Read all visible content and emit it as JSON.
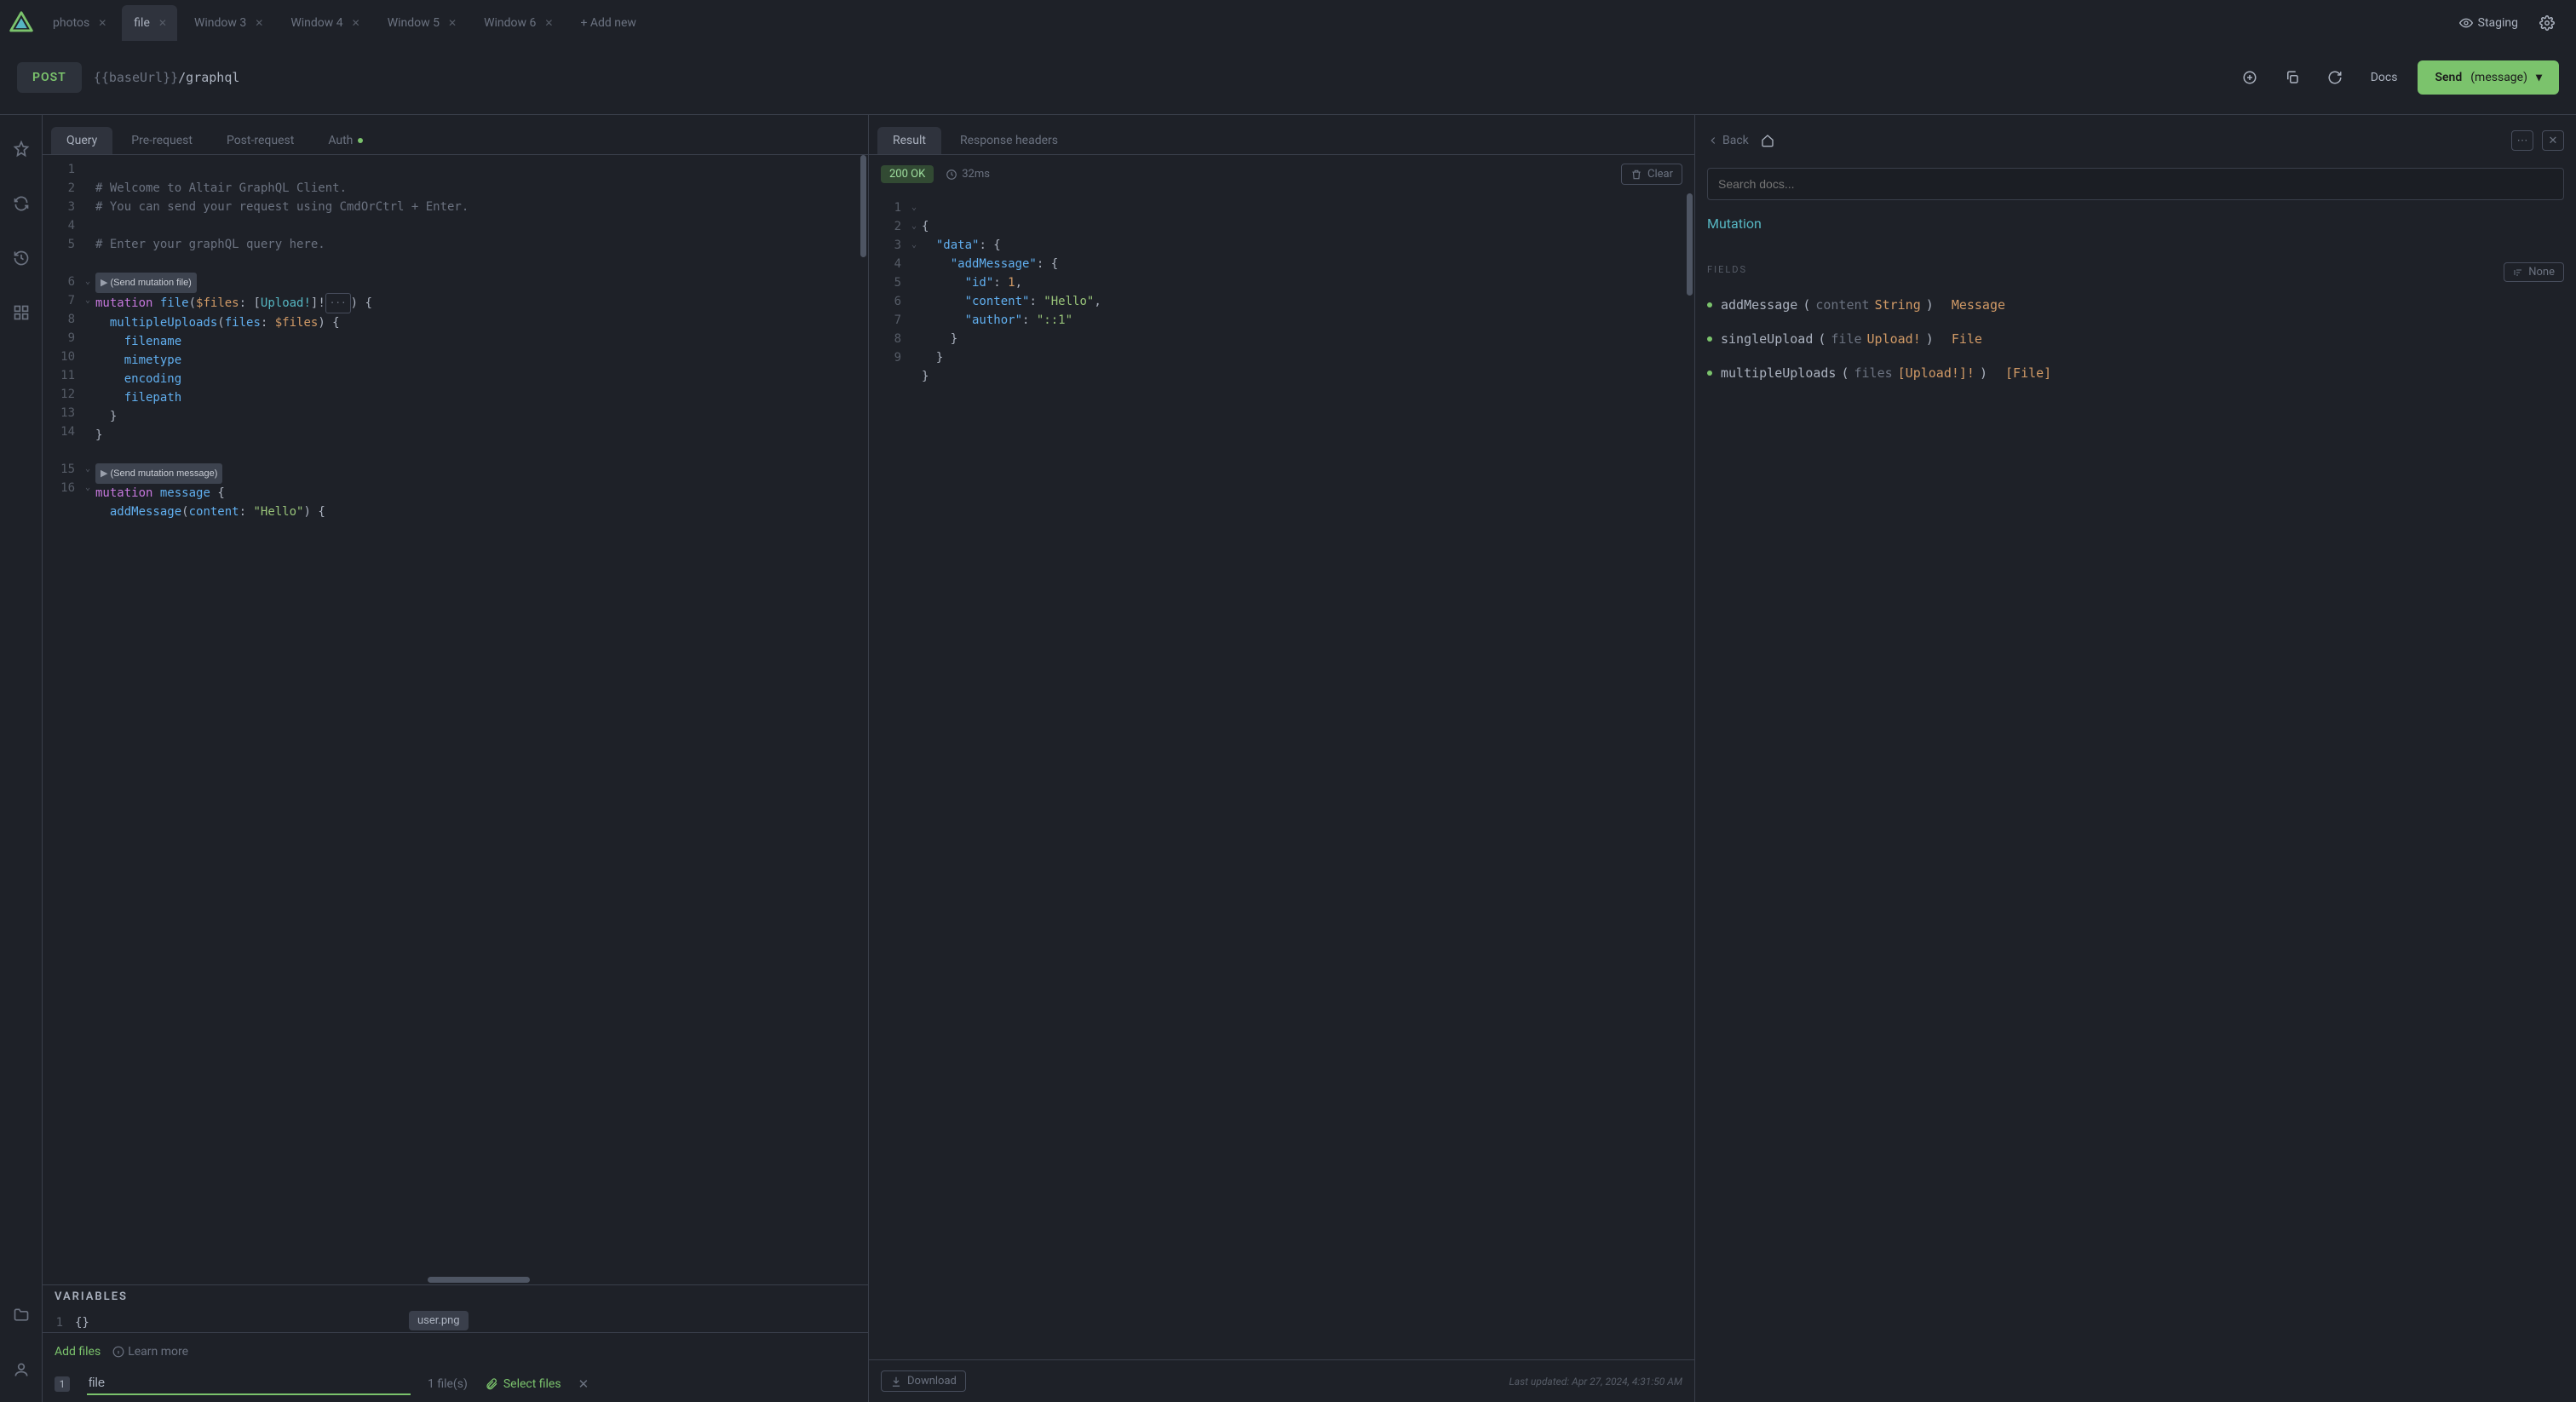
{
  "tabs": [
    {
      "label": "photos"
    },
    {
      "label": "file",
      "active": true
    },
    {
      "label": "Window 3"
    },
    {
      "label": "Window 4"
    },
    {
      "label": "Window 5"
    },
    {
      "label": "Window 6"
    }
  ],
  "add_new_label": "+ Add new",
  "env_label": "Staging",
  "method": "POST",
  "url_var": "{{baseUrl}}",
  "url_path": "/graphql",
  "docs_link": "Docs",
  "send_label": "Send",
  "send_op_suffix": "(message)",
  "query_tabs": {
    "query": "Query",
    "pre": "Pre-request",
    "post": "Post-request",
    "auth": "Auth"
  },
  "editor_lines": [
    "1",
    "2",
    "3",
    "4",
    "5",
    "6",
    "7",
    "8",
    "9",
    "10",
    "11",
    "12",
    "13",
    "14",
    "15",
    "16"
  ],
  "code": {
    "c1": "# Welcome to Altair GraphQL Client.",
    "c2": "# You can send your request using CmdOrCtrl + Enter.",
    "c3": "",
    "c4": "# Enter your graphQL query here.",
    "lens_file": "(Send mutation file)",
    "l6_kw": "mutation",
    "l6_name": "file",
    "l6_arg": "$files",
    "l6_type": "Upload!",
    "l7_field": "multipleUploads",
    "l7_arg": "files",
    "l7_val": "$files",
    "l8": "filename",
    "l9": "mimetype",
    "l10": "encoding",
    "l11": "filepath",
    "lens_msg": "(Send mutation message)",
    "l15_kw": "mutation",
    "l15_name": "message",
    "l16_field": "addMessage",
    "l16_arg": "content",
    "l16_val": "\"Hello\""
  },
  "variables_label": "VARIABLES",
  "variables_line_no": "1",
  "variables_body": "{}",
  "files": {
    "add_label": "Add files",
    "learn_label": "Learn more",
    "chip": "user.png",
    "entry_index": "1",
    "entry_name": "file",
    "count_label": "1 file(s)",
    "select_label": "Select files"
  },
  "result_tabs": {
    "result": "Result",
    "headers": "Response headers"
  },
  "status": "200 OK",
  "timing": "32ms",
  "clear_label": "Clear",
  "download_label": "Download",
  "timestamp": "Last updated: Apr 27, 2024, 4:31:50 AM",
  "result_lines": [
    "1",
    "2",
    "3",
    "4",
    "5",
    "6",
    "7",
    "8",
    "9"
  ],
  "result": {
    "k_data": "\"data\"",
    "k_addMessage": "\"addMessage\"",
    "k_id": "\"id\"",
    "v_id": "1",
    "k_content": "\"content\"",
    "v_content": "\"Hello\"",
    "k_author": "\"author\"",
    "v_author": "\"::1\""
  },
  "docs": {
    "back": "Back",
    "search_placeholder": "Search docs...",
    "type": "Mutation",
    "fields_label": "FIELDS",
    "sort": "None",
    "rows": [
      {
        "name": "addMessage",
        "args": [
          {
            "n": "content",
            "t": "String"
          }
        ],
        "ret": "Message"
      },
      {
        "name": "singleUpload",
        "args": [
          {
            "n": "file",
            "t": "Upload!"
          }
        ],
        "ret": "File"
      },
      {
        "name": "multipleUploads",
        "args": [
          {
            "n": "files",
            "t": "[Upload!]!"
          }
        ],
        "ret": "[File]"
      }
    ]
  }
}
